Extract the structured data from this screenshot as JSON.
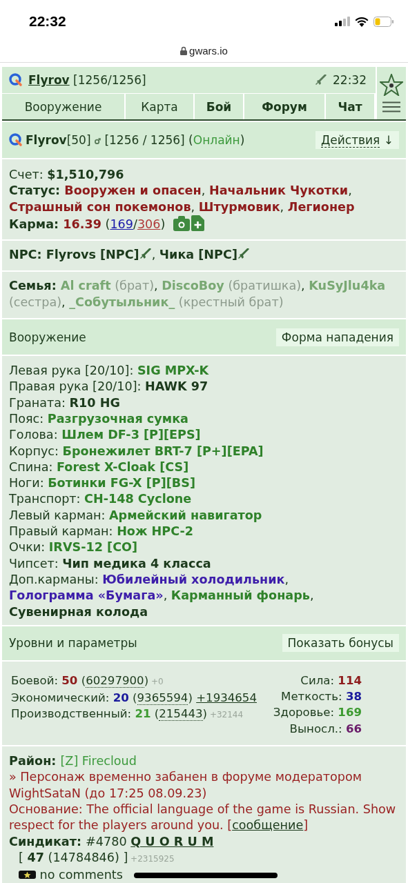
{
  "status_bar": {
    "time": "22:32"
  },
  "address_bar": {
    "url": "gwars.io"
  },
  "top_bar": {
    "player": "Flyrov",
    "hp": "[1256/1256]",
    "time": "22:32"
  },
  "nav_tabs": [
    {
      "label": "Вооружение",
      "kind": "normal"
    },
    {
      "label": "Карта",
      "kind": "normal"
    },
    {
      "label": "Бой",
      "kind": "bold"
    },
    {
      "label": "Форум",
      "kind": "bold"
    },
    {
      "label": "Чат",
      "kind": "bold"
    }
  ],
  "profile": {
    "line": [
      {
        "text": "Flyrov",
        "kind": "bold"
      },
      {
        "text": "[50] ",
        "kind": "plain"
      },
      {
        "kind": "male"
      },
      {
        "text": " [1256 / 1256] (",
        "kind": "plain"
      },
      {
        "text": "Онлайн",
        "kind": "online"
      },
      {
        "text": ")",
        "kind": "plain"
      }
    ],
    "actions": "Действия",
    "actions_arrow": "↓"
  },
  "info": [
    [
      {
        "text": "Счет: ",
        "kind": "plain"
      },
      {
        "text": "$1,510,796",
        "kind": "bold"
      }
    ],
    [
      {
        "text": "Статус: ",
        "kind": "bold"
      },
      {
        "text": "Вооружен и опасен",
        "kind": "red"
      },
      {
        "text": ", ",
        "kind": "plain"
      },
      {
        "text": "Начальник Чукотки",
        "kind": "red"
      },
      {
        "text": ", ",
        "kind": "plain"
      },
      {
        "text": "Страшный сон покемонов",
        "kind": "red"
      },
      {
        "text": ", ",
        "kind": "plain"
      },
      {
        "text": "Штурмовик",
        "kind": "red"
      },
      {
        "text": ", ",
        "kind": "plain"
      },
      {
        "text": "Легионер",
        "kind": "red"
      }
    ],
    [
      {
        "text": "Карма: ",
        "kind": "bold"
      },
      {
        "text": "16.39",
        "kind": "red"
      },
      {
        "text": " (",
        "kind": "plain"
      },
      {
        "text": "169",
        "kind": "link-blue"
      },
      {
        "text": "/",
        "kind": "plain"
      },
      {
        "text": "306",
        "kind": "link-red"
      },
      {
        "text": ")",
        "kind": "plain"
      },
      {
        "kind": "camera"
      },
      {
        "kind": "add-file"
      }
    ]
  ],
  "npc": [
    {
      "text": "NPC: Flyrovs [NPC]",
      "kind": "bold"
    },
    {
      "kind": "gun"
    },
    {
      "text": ", ",
      "kind": "plain"
    },
    {
      "text": "Чика [NPC]",
      "kind": "bold"
    },
    {
      "kind": "gun"
    }
  ],
  "family": [
    {
      "text": "Семья: ",
      "kind": "bold"
    },
    {
      "text": "Al craft",
      "kind": "family"
    },
    {
      "text": " (брат)",
      "kind": "muted"
    },
    {
      "text": ", ",
      "kind": "plain"
    },
    {
      "text": "DiscoBoy",
      "kind": "family"
    },
    {
      "text": " (братишка)",
      "kind": "muted"
    },
    {
      "text": ", ",
      "kind": "plain"
    },
    {
      "text": "KuSyJlu4ka",
      "kind": "family"
    },
    {
      "text": " (сестра)",
      "kind": "muted"
    },
    {
      "text": ", ",
      "kind": "plain"
    },
    {
      "text": "_Собутыльник_",
      "kind": "family"
    },
    {
      "text": " (крестный брат)",
      "kind": "muted"
    }
  ],
  "weapons_section": {
    "title": "Вооружение",
    "button": "Форма нападения"
  },
  "equipment": [
    [
      {
        "text": "Левая рука [20/10]: ",
        "kind": "plain"
      },
      {
        "text": "SIG MPX-K",
        "kind": "item"
      }
    ],
    [
      {
        "text": "Правая рука [20/10]: ",
        "kind": "plain"
      },
      {
        "text": "HAWK 97",
        "kind": "bold"
      }
    ],
    [
      {
        "text": "Граната: ",
        "kind": "plain"
      },
      {
        "text": "R10 HG",
        "kind": "bold"
      }
    ],
    [
      {
        "text": "Пояс: ",
        "kind": "plain"
      },
      {
        "text": "Разгрузочная сумка",
        "kind": "item"
      }
    ],
    [
      {
        "text": "Голова: ",
        "kind": "plain"
      },
      {
        "text": "Шлем DF-3 [P][EPS]",
        "kind": "item"
      }
    ],
    [
      {
        "text": "Корпус: ",
        "kind": "plain"
      },
      {
        "text": "Бронежилет BRT-7 [P+][EPA]",
        "kind": "item"
      }
    ],
    [
      {
        "text": "Спина: ",
        "kind": "plain"
      },
      {
        "text": "Forest X-Cloak [CS]",
        "kind": "item"
      }
    ],
    [
      {
        "text": "Ноги: ",
        "kind": "plain"
      },
      {
        "text": "Ботинки FG-X [P][BS]",
        "kind": "item"
      }
    ],
    [
      {
        "text": "Транспорт: ",
        "kind": "plain"
      },
      {
        "text": "CH-148 Cyclone",
        "kind": "item"
      }
    ],
    [
      {
        "text": "Левый карман: ",
        "kind": "plain"
      },
      {
        "text": "Армейский навигатор",
        "kind": "item"
      }
    ],
    [
      {
        "text": "Правый карман: ",
        "kind": "plain"
      },
      {
        "text": "Нож HPC-2",
        "kind": "item"
      }
    ],
    [
      {
        "text": "Очки: ",
        "kind": "plain"
      },
      {
        "text": "IRVS-12 [CO]",
        "kind": "item"
      }
    ],
    [
      {
        "text": "Чипсет: ",
        "kind": "plain"
      },
      {
        "text": "Чип медика 4 класса",
        "kind": "bold"
      }
    ],
    [
      {
        "text": "Доп.карманы: ",
        "kind": "plain"
      },
      {
        "text": "Юбилейный холодильник",
        "kind": "unique"
      },
      {
        "text": ", ",
        "kind": "plain"
      },
      {
        "text": "Голограмма «Бумага»",
        "kind": "unique"
      },
      {
        "text": ", ",
        "kind": "plain"
      },
      {
        "text": "Карманный фонарь",
        "kind": "item"
      },
      {
        "text": ", ",
        "kind": "plain"
      },
      {
        "text": "Сувенирная колода",
        "kind": "bold"
      }
    ]
  ],
  "levels_section": {
    "title": "Уровни и параметры",
    "button": "Показать бонусы"
  },
  "levels": [
    [
      {
        "text": "Боевой: ",
        "kind": "plain"
      },
      {
        "text": "50",
        "kind": "red"
      },
      {
        "text": " (",
        "kind": "plain"
      },
      {
        "text": "60297900",
        "kind": "dotted"
      },
      {
        "text": ")",
        "kind": "plain"
      },
      {
        "text": " +0",
        "kind": "tiny"
      }
    ],
    [
      {
        "text": "Экономический: ",
        "kind": "plain"
      },
      {
        "text": "20",
        "kind": "blue"
      },
      {
        "text": " (",
        "kind": "plain"
      },
      {
        "text": "9365594",
        "kind": "dotted"
      },
      {
        "text": ") ",
        "kind": "plain"
      },
      {
        "text": "+1934654",
        "kind": "link"
      }
    ],
    [
      {
        "text": "Производственный: ",
        "kind": "plain"
      },
      {
        "text": "21",
        "kind": "lime"
      },
      {
        "text": " (",
        "kind": "plain"
      },
      {
        "text": "215443",
        "kind": "dotted"
      },
      {
        "text": ")",
        "kind": "plain"
      },
      {
        "text": " +32144",
        "kind": "tiny"
      }
    ]
  ],
  "stats": [
    [
      {
        "text": "Сила: ",
        "kind": "plain"
      },
      {
        "text": "114",
        "kind": "red"
      }
    ],
    [
      {
        "text": "Меткость: ",
        "kind": "plain"
      },
      {
        "text": "38",
        "kind": "blue"
      }
    ],
    [
      {
        "text": "Здоровье: ",
        "kind": "plain"
      },
      {
        "text": "169",
        "kind": "lime"
      }
    ],
    [
      {
        "text": "Выносл.: ",
        "kind": "plain"
      },
      {
        "text": "66",
        "kind": "purple"
      }
    ]
  ],
  "district": [
    [
      {
        "text": "Район: ",
        "kind": "bold"
      },
      {
        "text": "[Z] Firecloud",
        "kind": "green"
      }
    ],
    [
      {
        "text": " » Персонаж временно забанен в форуме модератором WightSataN (до 17:25 08.09.23)",
        "kind": "warn"
      }
    ],
    [
      {
        "text": "Основание: The official language of the game is Russian. Show respect for the players around you. [",
        "kind": "warn"
      },
      {
        "text": "сообщение",
        "kind": "link"
      },
      {
        "text": "]",
        "kind": "warn"
      }
    ],
    [
      {
        "text": "Синдикат: ",
        "kind": "bold"
      },
      {
        "text": "#4780 ",
        "kind": "plain"
      },
      {
        "text": "Q U O R U M",
        "kind": "link-bold"
      }
    ]
  ],
  "syndicate": [
    [
      {
        "text": "[ ",
        "kind": "plain"
      },
      {
        "text": "47",
        "kind": "bold"
      },
      {
        "text": " (14784846) ]",
        "kind": "plain"
      },
      {
        "text": " +2315925",
        "kind": "tiny"
      }
    ],
    [
      {
        "kind": "rank"
      },
      {
        "text": " no comments",
        "kind": "plain"
      }
    ]
  ]
}
